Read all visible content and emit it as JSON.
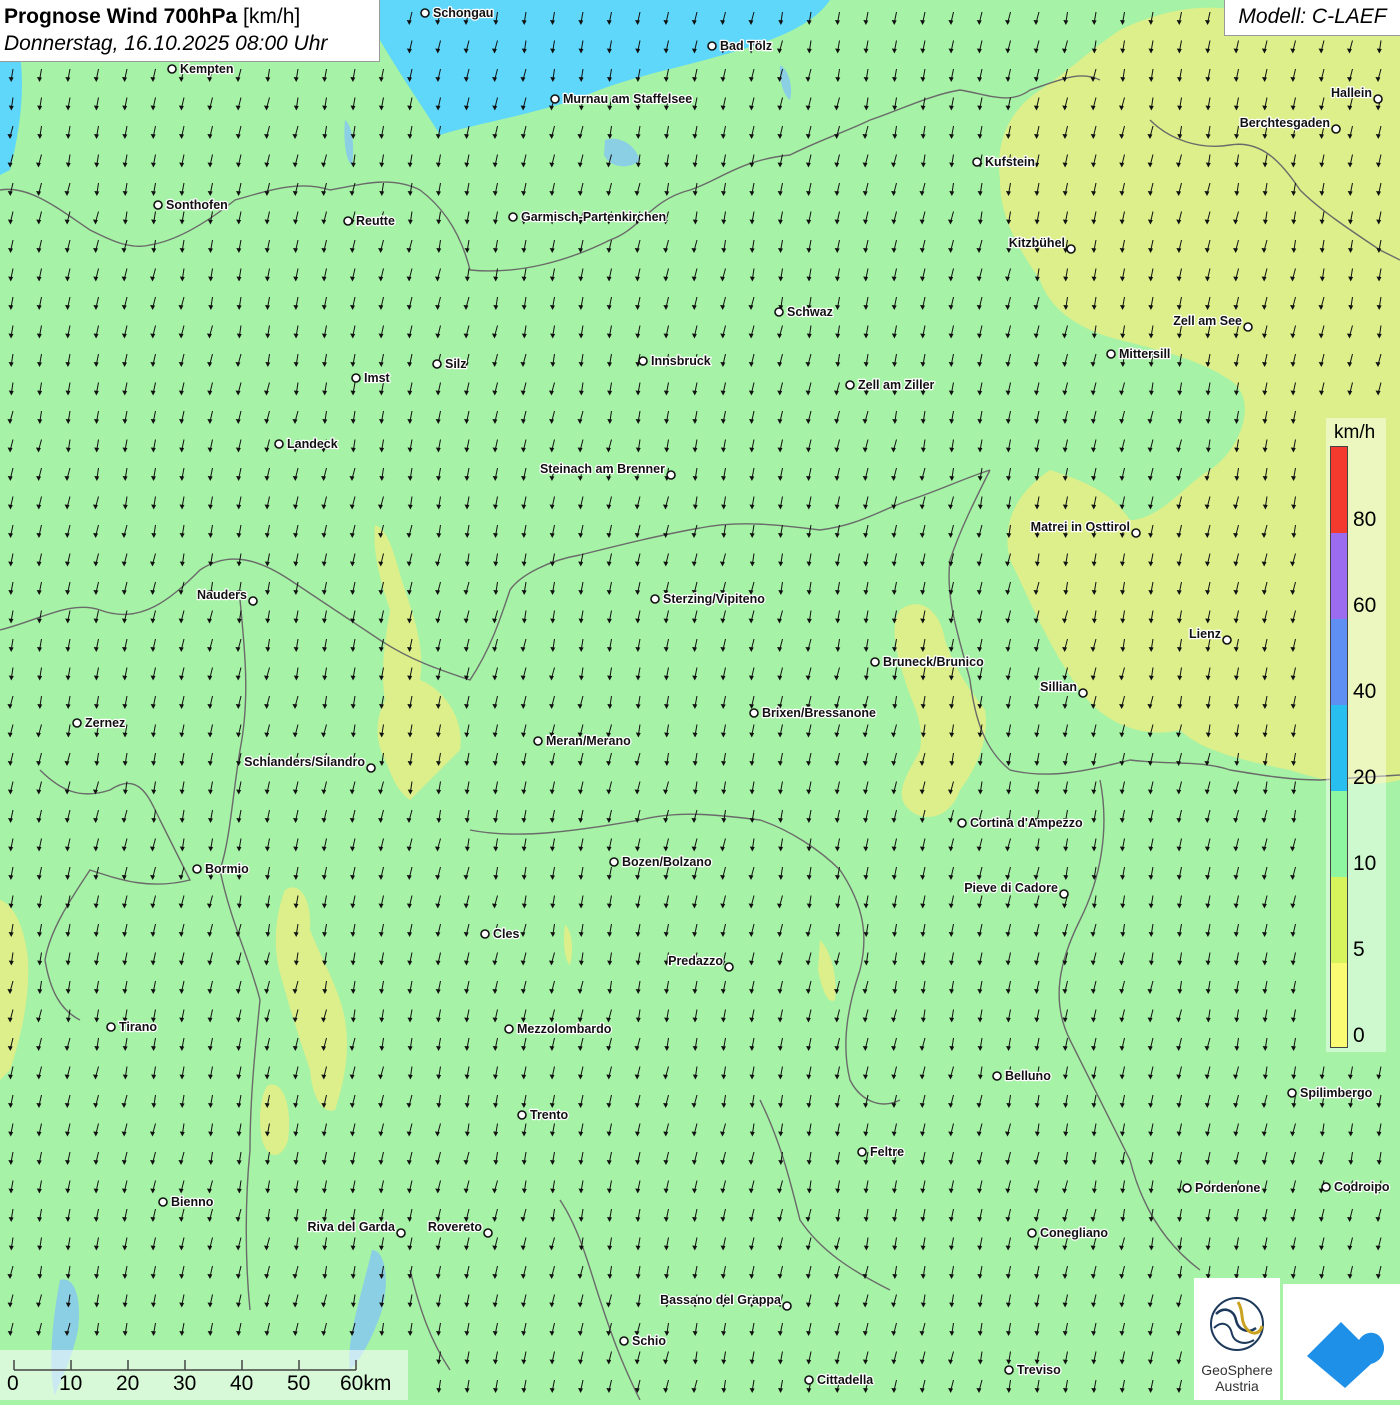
{
  "title": {
    "prefix": "Prognose Wind 700hPa",
    "unit": "[km/h]",
    "datetime": "Donnerstag, 16.10.2025 08:00 Uhr"
  },
  "model": "Modell: C-LAEF",
  "legend": {
    "unit": "km/h",
    "labels": [
      "80",
      "60",
      "40",
      "20",
      "10",
      "5",
      "0"
    ],
    "colors": [
      "#f43a2f",
      "#9b6cf0",
      "#5f8ff2",
      "#28bff0",
      "#8ef5a0",
      "#d7f45c",
      "#fafb73"
    ]
  },
  "scalebar": {
    "labels": [
      "0",
      "10",
      "20",
      "30",
      "40",
      "50",
      "60km"
    ]
  },
  "logo": {
    "geosphere_line1": "GeoSphere",
    "geosphere_line2": "Austria",
    "app_icon": "cloud-logo-icon"
  },
  "colors": {
    "base_green": "#a6f2a6",
    "lake_blue": "#5fd7fb",
    "low_wind_yellow": "#dcef8a"
  },
  "cities": [
    {
      "name": "Schongau",
      "label_side": "right"
    },
    {
      "name": "Bad Tölz",
      "label_side": "right"
    },
    {
      "name": "Kempten",
      "label_side": "right"
    },
    {
      "name": "Murnau am Staffelsee",
      "label_side": "right"
    },
    {
      "name": "Hallein",
      "label_side": "left"
    },
    {
      "name": "Berchtesgaden",
      "label_side": "left"
    },
    {
      "name": "Kufstein",
      "label_side": "right"
    },
    {
      "name": "Sonthofen",
      "label_side": "right"
    },
    {
      "name": "Reutte",
      "label_side": "right"
    },
    {
      "name": "Garmisch-Partenkirchen",
      "label_side": "right"
    },
    {
      "name": "Kitzbühel",
      "label_side": "left"
    },
    {
      "name": "Schwaz",
      "label_side": "right"
    },
    {
      "name": "Zell am See",
      "label_side": "left"
    },
    {
      "name": "Mittersill",
      "label_side": "right"
    },
    {
      "name": "Innsbruck",
      "label_side": "right"
    },
    {
      "name": "Silz",
      "label_side": "right"
    },
    {
      "name": "Imst",
      "label_side": "right"
    },
    {
      "name": "Zell am Ziller",
      "label_side": "right"
    },
    {
      "name": "Landeck",
      "label_side": "right"
    },
    {
      "name": "Steinach am Brenner",
      "label_side": "left"
    },
    {
      "name": "Matrei in Osttirol",
      "label_side": "left"
    },
    {
      "name": "Nauders",
      "label_side": "left"
    },
    {
      "name": "Sterzing/Vipiteno",
      "label_side": "right"
    },
    {
      "name": "Lienz",
      "label_side": "left"
    },
    {
      "name": "Bruneck/Brunico",
      "label_side": "right"
    },
    {
      "name": "Sillian",
      "label_side": "left"
    },
    {
      "name": "Brixen/Bressanone",
      "label_side": "right"
    },
    {
      "name": "Zernez",
      "label_side": "right"
    },
    {
      "name": "Meran/Merano",
      "label_side": "right"
    },
    {
      "name": "Schlanders/Silandro",
      "label_side": "left"
    },
    {
      "name": "Cortina d'Ampezzo",
      "label_side": "right"
    },
    {
      "name": "Bozen/Bolzano",
      "label_side": "right"
    },
    {
      "name": "Bormio",
      "label_side": "right"
    },
    {
      "name": "Pieve di Cadore",
      "label_side": "left"
    },
    {
      "name": "Cles",
      "label_side": "right"
    },
    {
      "name": "Predazzo",
      "label_side": "left"
    },
    {
      "name": "Tirano",
      "label_side": "right"
    },
    {
      "name": "Mezzolombardo",
      "label_side": "right"
    },
    {
      "name": "Belluno",
      "label_side": "right"
    },
    {
      "name": "Spilimbergo",
      "label_side": "right"
    },
    {
      "name": "Trento",
      "label_side": "right"
    },
    {
      "name": "Feltre",
      "label_side": "right"
    },
    {
      "name": "Pordenone",
      "label_side": "right"
    },
    {
      "name": "Codroipo",
      "label_side": "right"
    },
    {
      "name": "Bienno",
      "label_side": "right"
    },
    {
      "name": "Riva del Garda",
      "label_side": "left"
    },
    {
      "name": "Rovereto",
      "label_side": "left"
    },
    {
      "name": "Conegliano",
      "label_side": "right"
    },
    {
      "name": "Bassano del Grappa",
      "label_side": "left"
    },
    {
      "name": "Schio",
      "label_side": "right"
    },
    {
      "name": "Cittadella",
      "label_side": "right"
    },
    {
      "name": "Treviso",
      "label_side": "right"
    }
  ]
}
